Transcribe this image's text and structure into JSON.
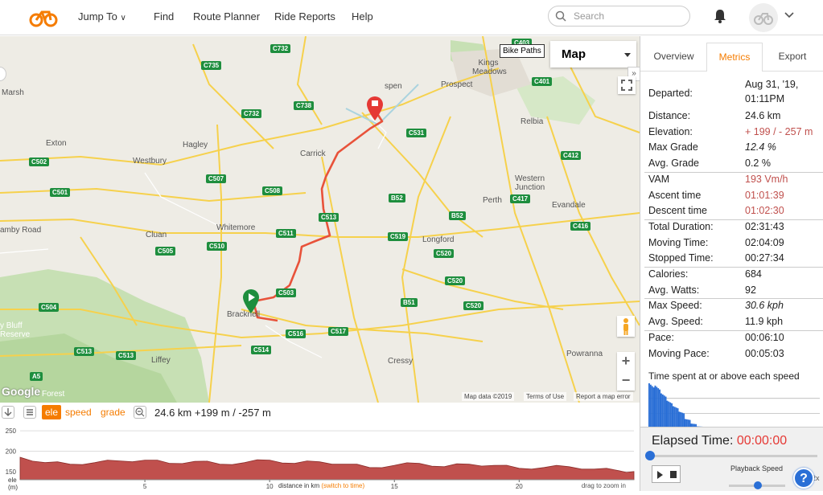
{
  "nav": {
    "items": [
      "Jump To",
      "Find",
      "Route Planner",
      "Ride Reports",
      "Help"
    ],
    "search_placeholder": "Search"
  },
  "map": {
    "bike_paths_label": "Bike Paths",
    "map_type": "Map",
    "places": [
      {
        "name": "Marsh"
      },
      {
        "name": "Exton"
      },
      {
        "name": "Hagley"
      },
      {
        "name": "Westbury"
      },
      {
        "name": "Carrick"
      },
      {
        "name": "Whitemore"
      },
      {
        "name": "Cluan"
      },
      {
        "name": "Bracknell"
      },
      {
        "name": "Liffey"
      },
      {
        "name": "Cressy"
      },
      {
        "name": "Longford"
      },
      {
        "name": "Perth"
      },
      {
        "name": "Evandale"
      },
      {
        "name": "Western Junction"
      },
      {
        "name": "Relbia"
      },
      {
        "name": "Prospect"
      },
      {
        "name": "Kings Meadows"
      },
      {
        "name": "Powranna"
      },
      {
        "name": "amby Road"
      },
      {
        "name": "y Bluff Reserve"
      },
      {
        "name": "Forest"
      },
      {
        "name": "spen"
      }
    ],
    "shields": [
      "C735",
      "C732",
      "C738",
      "C732",
      "C502",
      "C501",
      "C507",
      "C508",
      "C513",
      "C511",
      "C510",
      "C505",
      "C503",
      "C504",
      "C513",
      "C513",
      "C516",
      "C517",
      "C514",
      "C531",
      "B52",
      "B52",
      "C519",
      "C520",
      "C520",
      "B51",
      "C520",
      "C401",
      "C412",
      "C417",
      "C416",
      "C403",
      "A5"
    ],
    "attribution": {
      "data": "Map data ©2019",
      "terms": "Terms of Use",
      "report": "Report a map error"
    },
    "google": "Google"
  },
  "chartbar": {
    "tabs": {
      "ele": "ele",
      "speed": "speed",
      "grade": "grade"
    },
    "summary": "24.6 km +199 m / -257 m"
  },
  "chart_data": {
    "type": "area",
    "x": [
      0,
      1,
      2,
      3,
      4,
      5,
      6,
      7,
      8,
      9,
      10,
      11,
      12,
      13,
      14,
      15,
      16,
      17,
      18,
      19,
      20,
      21,
      22,
      23,
      24,
      24.6
    ],
    "values": [
      185,
      172,
      168,
      172,
      176,
      178,
      170,
      175,
      168,
      172,
      178,
      170,
      174,
      168,
      160,
      165,
      170,
      162,
      168,
      165,
      158,
      160,
      162,
      156,
      152,
      150
    ],
    "xlabel": "distance in km",
    "xlabel_link": "(switch to time)",
    "ylabel": "ele (m)",
    "yticks": [
      "250",
      "200",
      "150"
    ],
    "xticks": [
      "5",
      "10",
      "15",
      "20"
    ],
    "hint": "drag to zoom in",
    "ylim": [
      130,
      260
    ],
    "xlim": [
      0,
      24.6
    ],
    "color": "#c0504d"
  },
  "panel": {
    "tabs": [
      "Overview",
      "Metrics",
      "Export"
    ],
    "metrics": [
      {
        "label": "Departed:",
        "value": "Aug 31, '19,",
        "value2": "01:11PM"
      },
      {
        "label": "Distance:",
        "value": "24.6 km"
      },
      {
        "label": "Elevation:",
        "value": "+ 199 / - 257 m"
      },
      {
        "label": "Max Grade",
        "value": "12.4 %"
      },
      {
        "label": "Avg. Grade",
        "value": "0.2 %"
      },
      {
        "label": "VAM",
        "value": "193 Vm/h"
      },
      {
        "label": "Ascent time",
        "value": "01:01:39"
      },
      {
        "label": "Descent time",
        "value": "01:02:30"
      },
      {
        "label": "Total Duration:",
        "value": "02:31:43"
      },
      {
        "label": "Moving Time:",
        "value": "02:04:09"
      },
      {
        "label": "Stopped Time:",
        "value": "00:27:34"
      },
      {
        "label": "Calories:",
        "value": "684"
      },
      {
        "label": "Avg. Watts:",
        "value": "92"
      },
      {
        "label": "Max Speed:",
        "value": "30.6 kph"
      },
      {
        "label": "Avg. Speed:",
        "value": "11.9 kph"
      },
      {
        "label": "Pace:",
        "value": "00:06:10"
      },
      {
        "label": "Moving Pace:",
        "value": "00:05:03"
      }
    ],
    "hist_title": "Time spent at or above each speed",
    "hist_values": [
      1.0,
      0.95,
      0.78,
      0.62,
      0.5,
      0.38,
      0.22,
      0.12,
      0.06,
      0.03
    ],
    "elapsed_label": "Elapsed Time:",
    "elapsed_value": "00:00:00",
    "playback_speed_label": "Playback Speed",
    "playback_speed_value": "32x",
    "help": "?"
  },
  "colors": {
    "accent": "#f57c00",
    "route": "#e8523a",
    "start_pin": "#1e8e3e",
    "end_pin": "#e53935"
  }
}
